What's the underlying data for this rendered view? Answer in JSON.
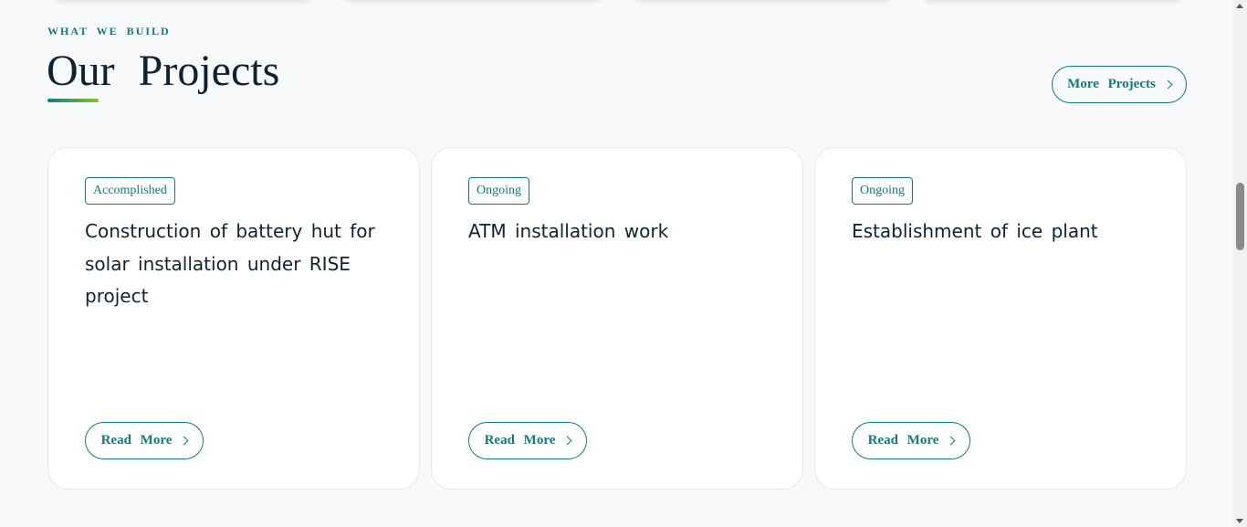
{
  "section": {
    "eyebrow": "WHAT WE BUILD",
    "title": "Our Projects",
    "more_button_label": "More Projects"
  },
  "projects": [
    {
      "status": "Accomplished",
      "title": "Construction of battery hut for solar installation under RISE project",
      "button_label": "Read More"
    },
    {
      "status": "Ongoing",
      "title": "ATM installation work",
      "button_label": "Read More"
    },
    {
      "status": "Ongoing",
      "title": "Establishment of ice plant",
      "button_label": "Read More"
    }
  ],
  "colors": {
    "accent": "#127a7f",
    "accent_secondary": "#84c32a",
    "heading": "#0f2233",
    "background": "#f7f9fb"
  },
  "icons": {
    "button_arrow": "chevron-right-icon"
  }
}
